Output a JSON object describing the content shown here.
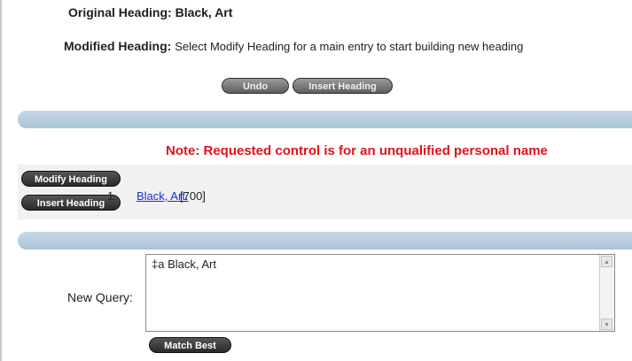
{
  "original_heading": {
    "label": "Original Heading:",
    "value": "Black, Art"
  },
  "modified_heading": {
    "label": "Modified Heading:",
    "value": "Select Modify Heading for a main entry to start building new heading"
  },
  "toolbar": {
    "undo_label": "Undo",
    "insert_label": "Insert Heading"
  },
  "note": "Note: Requested control is for an unqualified personal name",
  "results": [
    {
      "number": "1.",
      "heading": "Black, Art.",
      "tag": "[700]",
      "modify_label": "Modify Heading",
      "insert_label": "Insert Heading"
    }
  ],
  "query": {
    "label": "New Query:",
    "value": "‡a Black, Art",
    "match_label": "Match Best"
  },
  "icons": {
    "scroll_up": "scroll-up-arrow-icon",
    "scroll_down": "scroll-down-arrow-icon"
  },
  "colors": {
    "note": "#e0121b",
    "link": "#1b2fd1",
    "bar": "#b8cddd",
    "panel": "#f1f1f1"
  }
}
